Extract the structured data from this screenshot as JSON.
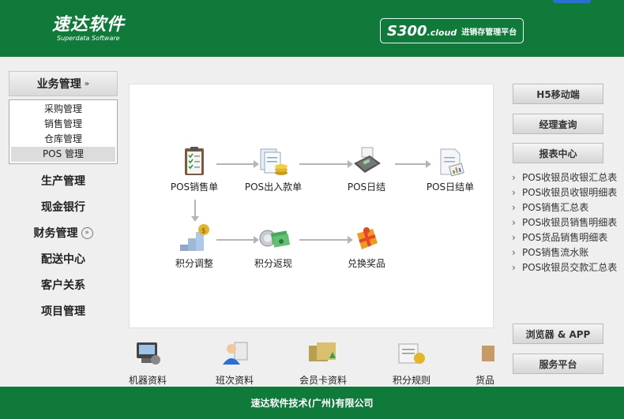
{
  "header": {
    "logo_main": "速达软件",
    "logo_sub": "Superdata Software",
    "product_code": "S300",
    "product_code_suffix": ".cloud",
    "product_name": "进销存管理平台"
  },
  "sidebar": {
    "expanded": {
      "label": "业务管理",
      "icon": "chevron-double-down-icon"
    },
    "submenu": [
      {
        "label": "采购管理"
      },
      {
        "label": "销售管理"
      },
      {
        "label": "仓库管理"
      },
      {
        "label": "POS 管理",
        "active": true
      }
    ],
    "items": [
      {
        "label": "生产管理"
      },
      {
        "label": "现金银行"
      },
      {
        "label": "财务管理",
        "icon": "chevron-circle-down-icon"
      },
      {
        "label": "配送中心"
      },
      {
        "label": "客户关系"
      },
      {
        "label": "项目管理"
      }
    ]
  },
  "flow": {
    "row1": [
      {
        "label": "POS销售单",
        "icon": "clipboard-checklist-icon"
      },
      {
        "label": "POS出入款单",
        "icon": "documents-coins-icon"
      },
      {
        "label": "POS日结",
        "icon": "pos-terminal-icon"
      },
      {
        "label": "POS日结单",
        "icon": "receipt-chart-icon"
      }
    ],
    "row2": [
      {
        "label": "积分调整",
        "icon": "coin-stairs-icon"
      },
      {
        "label": "积分返现",
        "icon": "cash-return-icon"
      },
      {
        "label": "兑换奖品",
        "icon": "gift-icon"
      }
    ]
  },
  "bottom_bar": [
    {
      "label": "机器资料",
      "icon": "machine-icon"
    },
    {
      "label": "班次资料",
      "icon": "staff-icon"
    },
    {
      "label": "会员卡资料",
      "icon": "member-card-icon"
    },
    {
      "label": "积分规则",
      "icon": "rules-icon"
    },
    {
      "label": "货品",
      "icon": "goods-icon"
    }
  ],
  "right_panel": {
    "buttons_top": [
      {
        "label": "H5移动端"
      },
      {
        "label": "经理查询"
      },
      {
        "label": "报表中心"
      }
    ],
    "reports": [
      {
        "label": "POS收银员收银汇总表"
      },
      {
        "label": "POS收银员收银明细表"
      },
      {
        "label": "POS销售汇总表"
      },
      {
        "label": "POS收银员销售明细表"
      },
      {
        "label": "POS货品销售明细表"
      },
      {
        "label": "POS销售流水账"
      },
      {
        "label": "POS收银员交款汇总表"
      }
    ],
    "buttons_bottom": [
      {
        "label": "浏览器 & APP"
      },
      {
        "label": "服务平台"
      }
    ]
  },
  "footer": {
    "text": "速达软件技术(广州)有限公司"
  },
  "colors": {
    "brand_green": "#0f7a3a",
    "panel_bg": "#efefef",
    "flow_arrow": "#b5b5b5"
  }
}
